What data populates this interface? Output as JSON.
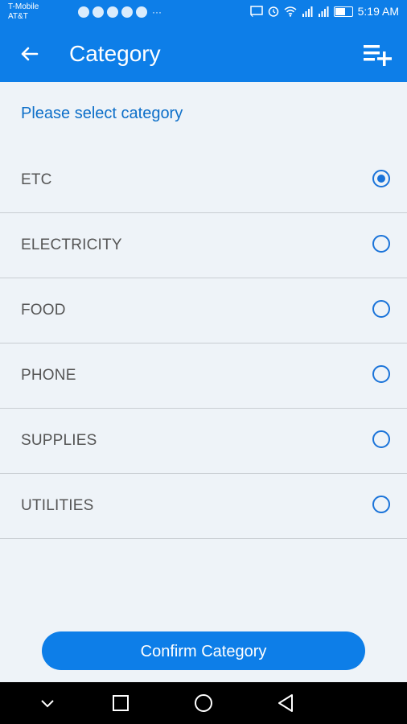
{
  "status_bar": {
    "carrier_1": "T-Mobile",
    "carrier_2": "AT&T",
    "more": "···",
    "time": "5:19 AM"
  },
  "app_bar": {
    "title": "Category"
  },
  "prompt": "Please select category",
  "categories": [
    {
      "label": "ETC",
      "selected": true
    },
    {
      "label": "ELECTRICITY",
      "selected": false
    },
    {
      "label": "FOOD",
      "selected": false
    },
    {
      "label": "PHONE",
      "selected": false
    },
    {
      "label": "SUPPLIES",
      "selected": false
    },
    {
      "label": "UTILITIES",
      "selected": false
    }
  ],
  "confirm_label": "Confirm Category",
  "colors": {
    "accent": "#0d7ee8",
    "radio": "#1a73d9",
    "background": "#eef3f8"
  }
}
